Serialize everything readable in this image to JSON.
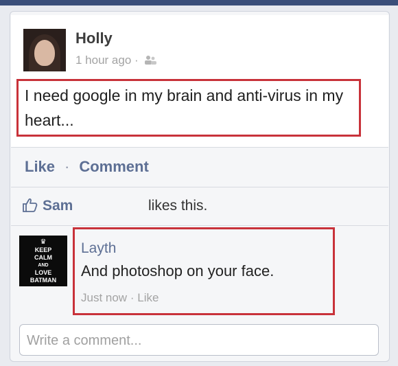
{
  "post": {
    "author": "Holly",
    "time": "1 hour ago",
    "separator": "·",
    "privacy_icon": "friends-icon",
    "text": "I need google in my brain and anti-virus in my heart..."
  },
  "actions": {
    "like_label": "Like",
    "separator": "·",
    "comment_label": "Comment"
  },
  "likes": {
    "icon": "thumbs-up-icon",
    "name": "Sam",
    "suffix": "likes this."
  },
  "comment": {
    "author": "Layth",
    "text": "And photoshop on your face.",
    "time": "Just now",
    "separator": "·",
    "like_label": "Like",
    "avatar_lines": [
      "KEEP",
      "CALM",
      "AND",
      "LOVE",
      "BATMAN"
    ]
  },
  "composer": {
    "placeholder": "Write a comment..."
  },
  "colors": {
    "link": "#5d6f94",
    "highlight": "#c8323a",
    "meta": "#a3a3a3"
  }
}
